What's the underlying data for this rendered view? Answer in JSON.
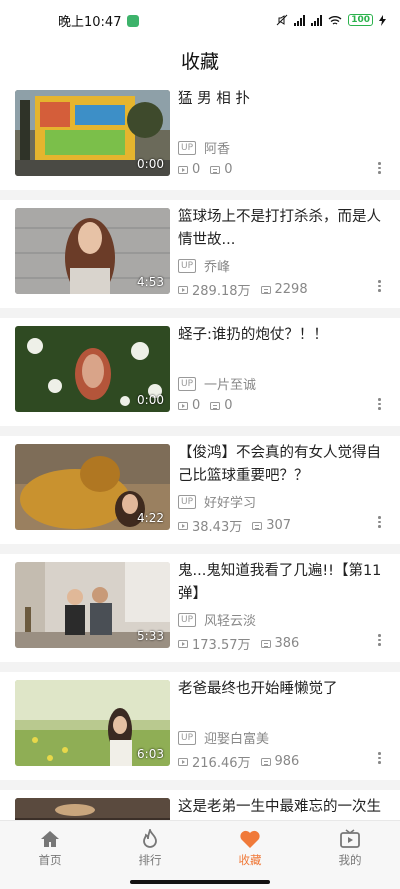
{
  "status_bar": {
    "time": "晚上10:47",
    "battery": "100"
  },
  "header": {
    "title": "收藏"
  },
  "videos": [
    {
      "title": "猛 男 相 扑",
      "uploader": "阿香",
      "duration": "0:00",
      "views": "0",
      "danmaku": "0",
      "up_tag": "UP"
    },
    {
      "title": "篮球场上不是打打杀杀，而是人情世故...",
      "uploader": "乔峰",
      "duration": "4:53",
      "views": "289.18万",
      "danmaku": "2298",
      "up_tag": "UP"
    },
    {
      "title": "蛏子:谁扔的炮仗？！！",
      "uploader": "一片至诚",
      "duration": "0:00",
      "views": "0",
      "danmaku": "0",
      "up_tag": "UP"
    },
    {
      "title": "【俊鸿】不会真的有女人觉得自己比篮球重要吧？？",
      "uploader": "好好学习",
      "duration": "4:22",
      "views": "38.43万",
      "danmaku": "307",
      "up_tag": "UP"
    },
    {
      "title": "鬼...鬼知道我看了几遍!!【第11弹】",
      "uploader": "风轻云淡",
      "duration": "5:33",
      "views": "173.57万",
      "danmaku": "386",
      "up_tag": "UP"
    },
    {
      "title": "老爸最终也开始睡懒觉了",
      "uploader": "迎娶白富美",
      "duration": "6:03",
      "views": "216.46万",
      "danmaku": "986",
      "up_tag": "UP"
    },
    {
      "title": "这是老弟一生中最难忘的一次生",
      "uploader": "",
      "duration": "",
      "views": "",
      "danmaku": "",
      "up_tag": ""
    }
  ],
  "tabs": [
    {
      "label": "首页",
      "icon": "home-icon"
    },
    {
      "label": "排行",
      "icon": "flame-icon"
    },
    {
      "label": "收藏",
      "icon": "heart-icon"
    },
    {
      "label": "我的",
      "icon": "tv-icon"
    }
  ],
  "colors": {
    "accent": "#f07a3a",
    "text": "#222222",
    "muted": "#888888"
  }
}
